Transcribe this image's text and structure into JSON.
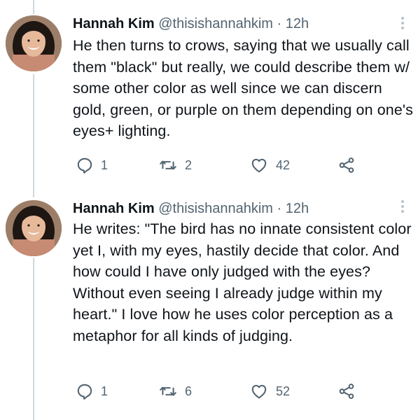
{
  "tweets": [
    {
      "author": {
        "name": "Hannah Kim",
        "handle": "@thisishannahkim"
      },
      "separator": "·",
      "time": "12h",
      "text": "He then turns to crows, saying that we usually call them \"black\" but really, we could describe them w/ some other color as well since we can discern gold, green, or purple on them depending on one's eyes+ lighting.",
      "stats": {
        "replies": "1",
        "retweets": "2",
        "likes": "42"
      },
      "icons": [
        "reply-icon",
        "retweet-icon",
        "like-icon",
        "share-icon",
        "more-icon"
      ]
    },
    {
      "author": {
        "name": "Hannah Kim",
        "handle": "@thisishannahkim"
      },
      "separator": "·",
      "time": "12h",
      "text": "He writes: \"The bird has no innate consistent color yet I, with my eyes, hastily decide that color. And how could I have only judged with the eyes? Without even seeing I already judge within my heart.\" I love how he uses color perception as a metaphor for all kinds of judging.",
      "stats": {
        "replies": "1",
        "retweets": "6",
        "likes": "52"
      },
      "icons": [
        "reply-icon",
        "retweet-icon",
        "like-icon",
        "share-icon",
        "more-icon"
      ]
    }
  ],
  "colors": {
    "text": "#0f1419",
    "secondary": "#536471",
    "thread_line": "#cfd9de",
    "background": "#ffffff"
  }
}
